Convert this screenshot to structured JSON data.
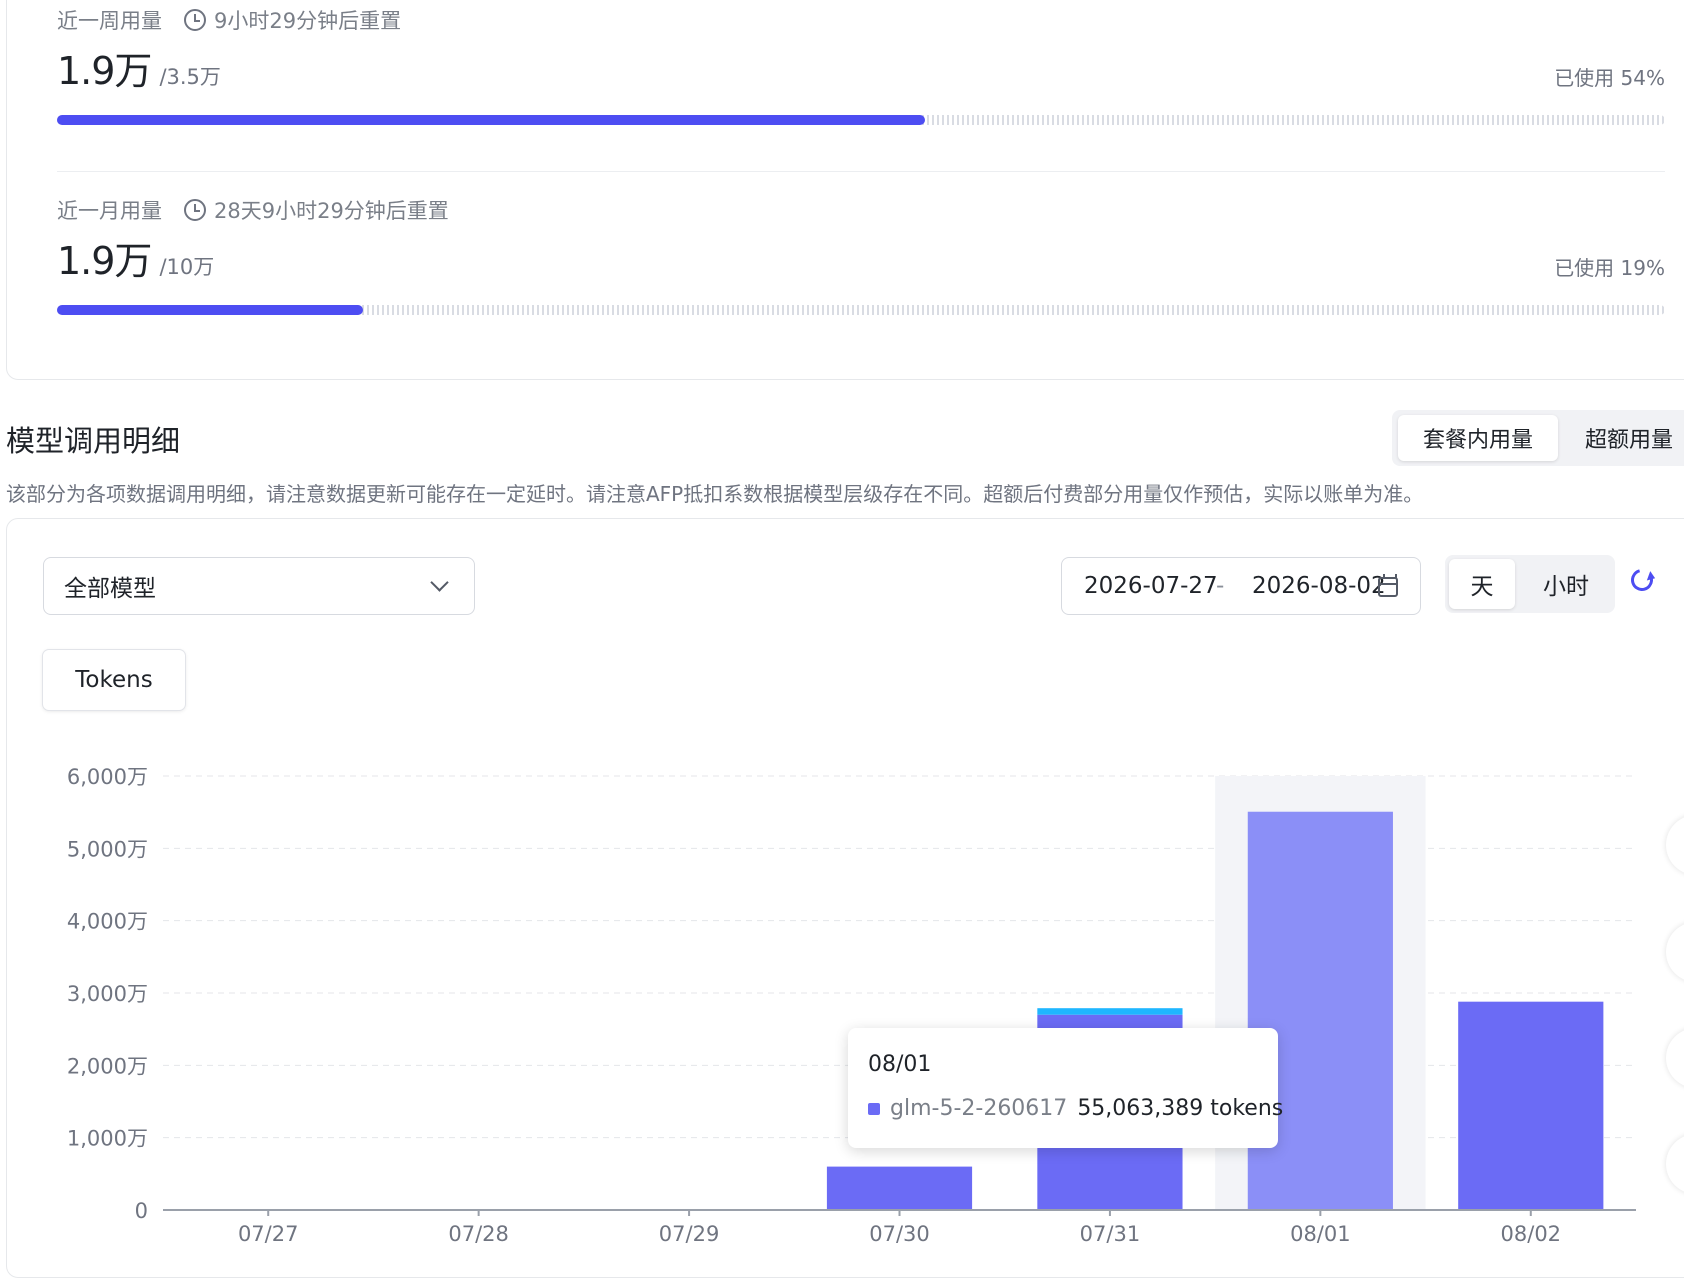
{
  "usage": {
    "weekly": {
      "label": "近一周用量",
      "reset_text": "9小时29分钟后重置",
      "used": "1.9万",
      "total": "/3.5万",
      "used_pct_text": "已使用 54%",
      "percent": 54
    },
    "monthly": {
      "label": "近一月用量",
      "reset_text": "28天9小时29分钟后重置",
      "used": "1.9万",
      "total": "/10万",
      "used_pct_text": "已使用 19%",
      "percent": 19
    }
  },
  "section": {
    "title": "模型调用明细",
    "tabs": [
      {
        "label": "套餐内用量",
        "active": true
      },
      {
        "label": "超额用量",
        "active": false
      }
    ],
    "description": "该部分为各项数据调用明细，请注意数据更新可能存在一定延时。请注意AFP抵扣系数根据模型层级存在不同。超额后付费部分用量仅作预估，实际以账单为准。"
  },
  "filters": {
    "model_select": "全部模型",
    "date_start": "2026-07-27",
    "date_sep": "-",
    "date_end": "2026-08-02",
    "granularity": [
      {
        "label": "天",
        "active": true
      },
      {
        "label": "小时",
        "active": false
      }
    ],
    "metric_tab": "Tokens"
  },
  "colors": {
    "accent": "#4d4df2",
    "bar_primary": "#6b6bf5",
    "bar_highlight": "#8b8ff7",
    "bar_secondary": "#1fb6ff"
  },
  "chart_data": {
    "type": "bar",
    "stacked": true,
    "categories": [
      "07/27",
      "07/28",
      "07/29",
      "07/30",
      "07/31",
      "08/01",
      "08/02"
    ],
    "y_ticks": [
      "0",
      "1,000万",
      "2,000万",
      "3,000万",
      "4,000万",
      "5,000万",
      "6,000万"
    ],
    "ylim": [
      0,
      6000
    ],
    "y_unit": "万",
    "grid": true,
    "highlighted_category": "08/01",
    "series": [
      {
        "name": "glm-5-2-260617",
        "color": "#6b6bf5",
        "values": [
          0,
          0,
          0,
          600,
          2700,
          5506,
          2880
        ]
      },
      {
        "color": "#1fb6ff",
        "values": [
          0,
          0,
          0,
          0,
          90,
          0,
          0
        ]
      }
    ],
    "tooltip": {
      "date": "08/01",
      "series": "glm-5-2-260617",
      "value": "55,063,389 tokens"
    }
  }
}
